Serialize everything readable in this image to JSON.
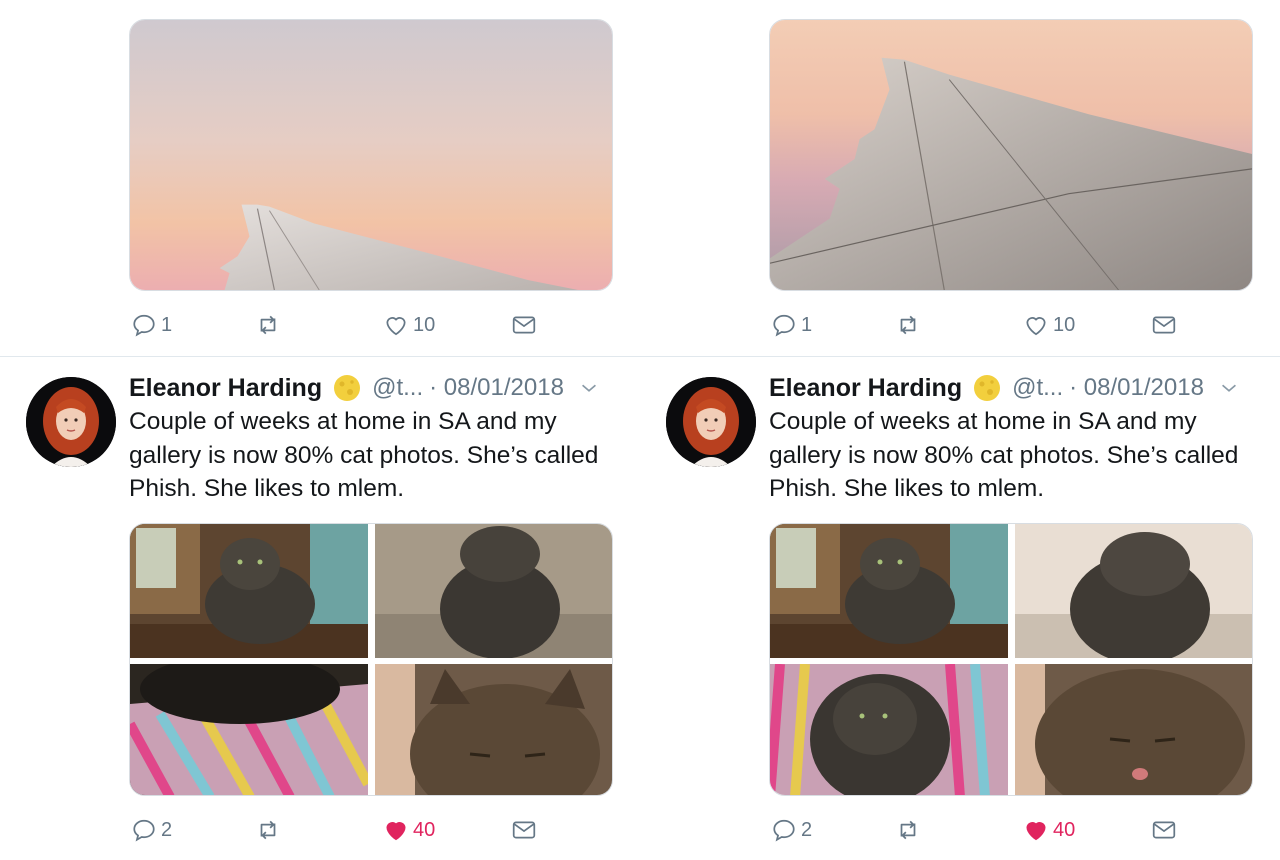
{
  "panels": [
    {
      "top_tweet": {
        "reply_count": "1",
        "retweet_count": "",
        "like_count": "10"
      },
      "tweet": {
        "author_name": "Eleanor Harding",
        "handle": "@t...",
        "date": "· 08/01/2018",
        "text": "Couple of weeks at home in SA and my gallery is now 80% cat photos. She’s called Phish. She likes to mlem.",
        "reply_count": "2",
        "retweet_count": "",
        "like_count": "40",
        "liked": true
      }
    },
    {
      "top_tweet": {
        "reply_count": "1",
        "retweet_count": "",
        "like_count": "10"
      },
      "tweet": {
        "author_name": "Eleanor Harding",
        "handle": "@t...",
        "date": "· 08/01/2018",
        "text": "Couple of weeks at home in SA and my gallery is now 80% cat photos. She’s called Phish. She likes to mlem.",
        "reply_count": "2",
        "retweet_count": "",
        "like_count": "40",
        "liked": true
      }
    }
  ],
  "icons": {
    "reply": "reply-icon",
    "retweet": "retweet-icon",
    "like": "heart-icon",
    "dm": "mail-icon",
    "badge": "moon-emoji-icon",
    "menu": "chevron-down-icon"
  },
  "colors": {
    "text": "#14171a",
    "secondary": "#657786",
    "like_active": "#e0245e",
    "divider": "#e1e8ed"
  }
}
